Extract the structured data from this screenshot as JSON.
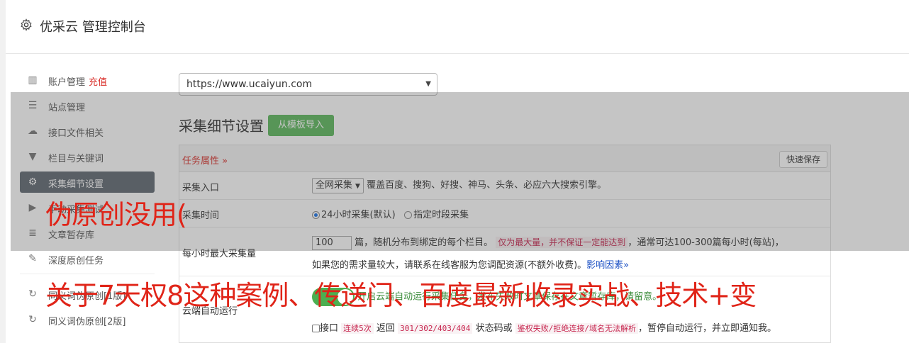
{
  "header": {
    "title": "优采云 管理控制台",
    "icon": "gear-icon"
  },
  "sidebar": {
    "items": [
      {
        "label": "账户管理",
        "extra": "充值",
        "icon": "bar-chart-icon",
        "glyph": "▥"
      },
      {
        "label": "站点管理",
        "icon": "server-icon",
        "glyph": "☰"
      },
      {
        "label": "接口文件相关",
        "icon": "cloud-upload-icon",
        "glyph": "☁"
      },
      {
        "label": "栏目与关键词",
        "icon": "filter-icon",
        "glyph": "▼"
      },
      {
        "label": "采集细节设置",
        "icon": "cogs-icon",
        "glyph": "⚙",
        "active": true
      },
      {
        "label": "手动采集测试",
        "icon": "play-circle-icon",
        "glyph": "▶"
      },
      {
        "label": "文章暂存库",
        "icon": "database-icon",
        "glyph": "≣"
      },
      {
        "label": "深度原创任务",
        "icon": "edit-icon",
        "glyph": "✎"
      },
      {
        "label": "同义词伪原创[1版]",
        "icon": "refresh-icon",
        "glyph": "↻"
      },
      {
        "label": "同义词伪原创[2版]",
        "icon": "refresh-icon",
        "glyph": "↻"
      }
    ]
  },
  "site_select": {
    "value": "https://www.ucaiyun.com"
  },
  "section": {
    "title": "采集细节设置",
    "template_button": "从模板导入"
  },
  "panel": {
    "task_attr": "任务属性",
    "quick_save": "快速保存",
    "rows": {
      "entry": {
        "label": "采集入口",
        "select": "全网采集",
        "desc": "覆盖百度、搜狗、好搜、神马、头条、必应六大搜索引擎。"
      },
      "time": {
        "label": "采集时间",
        "opt1": "24小时采集(默认)",
        "opt2": "指定时段采集"
      },
      "max": {
        "label": "每小时最大采集量",
        "value": "100",
        "text1": "篇，随机分布到绑定的每个栏目。",
        "warn": "仅为最大量，并不保证一定能达到",
        "text2": "，通常可达100-300篇每小时(每站)，",
        "text3": "如果您的需求量较大，请联系在线客服为您调配资源(不额外收费)。",
        "link": "影响因素"
      },
      "cloud": {
        "label": "云端自动运行",
        "desc": "开启云端自动运行采集任务，发布失败时文章保存在文章暂存库，请留意。",
        "iface": "接口",
        "consec": "连续5次",
        "ret": "返回",
        "codes": "301/302/403/404",
        "or": "状态码或",
        "auth": "鉴权失败/拒绝连接/域名无法解析",
        "tail": "，暂停自动运行，并立即通知我。"
      }
    }
  },
  "overlay_text": {
    "line1": "伪原创没用(",
    "line2": "关于7天权8这种案例、传送门、百度最新收录实战、技术+变"
  }
}
